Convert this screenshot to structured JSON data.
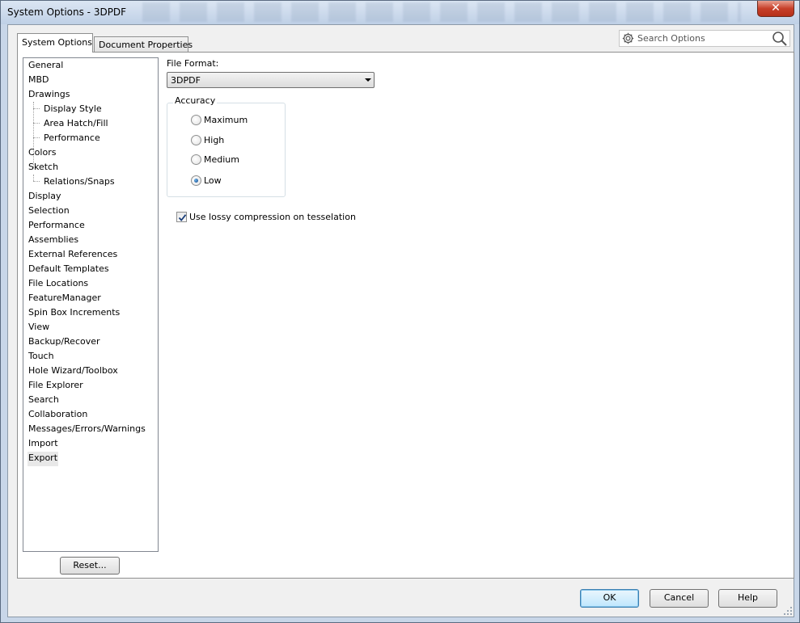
{
  "window": {
    "title": "System Options - 3DPDF",
    "close_glyph": "✕"
  },
  "tabs": [
    {
      "label": "System Options",
      "active": true
    },
    {
      "label": "Document Properties",
      "active": false
    }
  ],
  "search": {
    "placeholder": "Search Options",
    "left_icon": "gear-icon",
    "right_icon": "magnifier-icon"
  },
  "tree": {
    "items": [
      {
        "label": "General",
        "level": 0
      },
      {
        "label": "MBD",
        "level": 0
      },
      {
        "label": "Drawings",
        "level": 0
      },
      {
        "label": "Display Style",
        "level": 1
      },
      {
        "label": "Area Hatch/Fill",
        "level": 1
      },
      {
        "label": "Performance",
        "level": 1
      },
      {
        "label": "Colors",
        "level": 0
      },
      {
        "label": "Sketch",
        "level": 0
      },
      {
        "label": "Relations/Snaps",
        "level": 1
      },
      {
        "label": "Display",
        "level": 0
      },
      {
        "label": "Selection",
        "level": 0
      },
      {
        "label": "Performance",
        "level": 0
      },
      {
        "label": "Assemblies",
        "level": 0
      },
      {
        "label": "External References",
        "level": 0
      },
      {
        "label": "Default Templates",
        "level": 0
      },
      {
        "label": "File Locations",
        "level": 0
      },
      {
        "label": "FeatureManager",
        "level": 0
      },
      {
        "label": "Spin Box Increments",
        "level": 0
      },
      {
        "label": "View",
        "level": 0
      },
      {
        "label": "Backup/Recover",
        "level": 0
      },
      {
        "label": "Touch",
        "level": 0
      },
      {
        "label": "Hole Wizard/Toolbox",
        "level": 0
      },
      {
        "label": "File Explorer",
        "level": 0
      },
      {
        "label": "Search",
        "level": 0
      },
      {
        "label": "Collaboration",
        "level": 0
      },
      {
        "label": "Messages/Errors/Warnings",
        "level": 0
      },
      {
        "label": "Import",
        "level": 0
      },
      {
        "label": "Export",
        "level": 0,
        "selected": true
      }
    ],
    "reset_label": "Reset..."
  },
  "export_options": {
    "file_format_label": "File Format:",
    "file_format_value": "3DPDF",
    "accuracy_title": "Accuracy",
    "accuracy_options": [
      {
        "label": "Maximum",
        "checked": false
      },
      {
        "label": "High",
        "checked": false
      },
      {
        "label": "Medium",
        "checked": false
      },
      {
        "label": "Low",
        "checked": true
      }
    ],
    "lossy_compression_label": "Use lossy compression on tesselation",
    "lossy_compression_checked": true
  },
  "footer": {
    "ok_label": "OK",
    "cancel_label": "Cancel",
    "help_label": "Help"
  }
}
